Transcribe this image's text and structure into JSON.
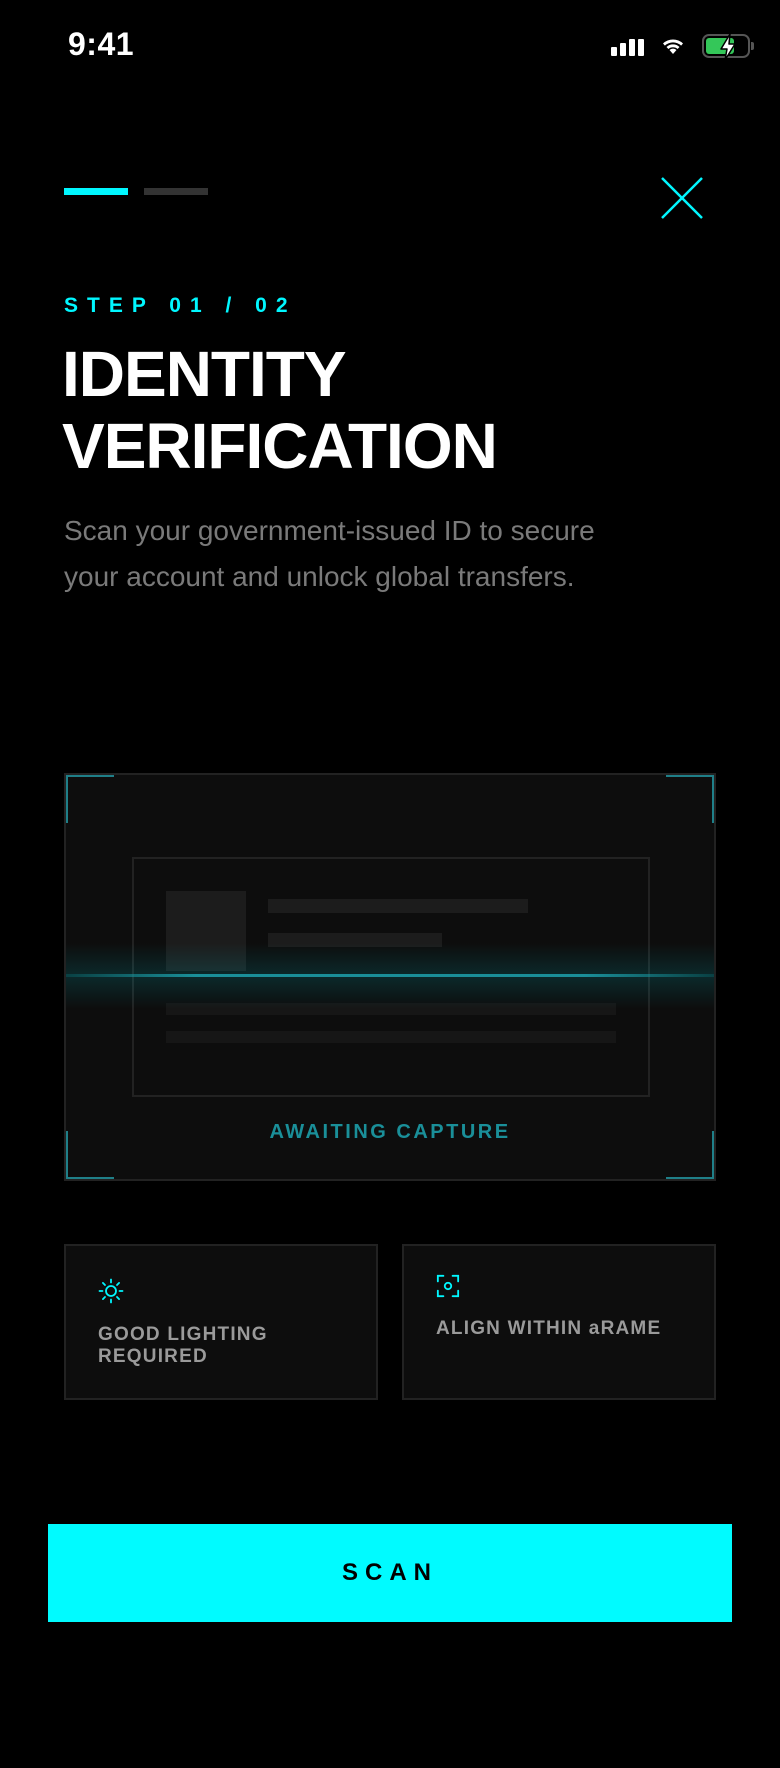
{
  "status_bar": {
    "time": "9:41"
  },
  "progress": {
    "current_step": 1,
    "total_steps": 2
  },
  "header": {
    "step_label": "STEP 01 / 02",
    "title_line1": "IDENTITY",
    "title_line2": "VERIFICATION",
    "subtitle": "Scan your government-issued ID to secure your account and unlock global transfers."
  },
  "scanner": {
    "status": "AWAITING CAPTURE"
  },
  "tips": [
    {
      "icon": "sun-icon",
      "label": "GOOD LIGHTING REQUIRED"
    },
    {
      "icon": "focus-frame-icon",
      "label": "ALIGN WITHIN aRAME"
    }
  ],
  "actions": {
    "scan_label": "SCAN"
  },
  "colors": {
    "accent": "#00f7ff",
    "accent_dim": "#1a8f99",
    "background": "#000000",
    "surface": "#0d0d0d",
    "battery": "#34c759"
  }
}
